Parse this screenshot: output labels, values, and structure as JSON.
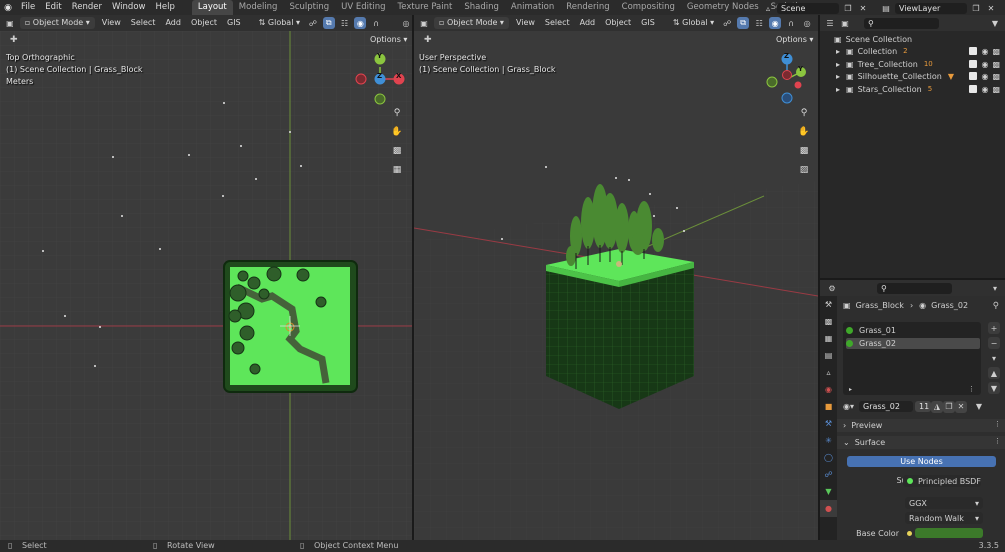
{
  "topbar": {
    "menus": [
      "File",
      "Edit",
      "Render",
      "Window",
      "Help"
    ],
    "workspaces": [
      "Layout",
      "Modeling",
      "Sculpting",
      "UV Editing",
      "Texture Paint",
      "Shading",
      "Animation",
      "Rendering",
      "Compositing",
      "Geometry Nodes",
      "Scripting"
    ],
    "active_workspace": "Layout",
    "add_tab": "+",
    "scene_name": "Scene",
    "view_layer": "ViewLayer"
  },
  "viewport_left": {
    "mode": "Object Mode",
    "menus": [
      "View",
      "Select",
      "Add",
      "Object",
      "GIS"
    ],
    "transform": "Global",
    "options": "Options",
    "info_line1": "Top Orthographic",
    "info_line2": "(1) Scene Collection | Grass_Block",
    "info_line3": "Meters",
    "axis_y": "Y",
    "axis_x": "X",
    "axis_z": "Z"
  },
  "viewport_right": {
    "mode": "Object Mode",
    "menus": [
      "View",
      "Select",
      "Add",
      "Object",
      "GIS"
    ],
    "transform": "Global",
    "options": "Options",
    "info_line1": "User Perspective",
    "info_line2": "(1) Scene Collection | Grass_Block",
    "axis_z": "Z",
    "axis_y": "Y"
  },
  "outliner": {
    "root": "Scene Collection",
    "items": [
      {
        "label": "Collection",
        "badge": "2"
      },
      {
        "label": "Tree_Collection",
        "badge": "10"
      },
      {
        "label": "Silhouette_Collection",
        "badge": ""
      },
      {
        "label": "Stars_Collection",
        "badge": "5"
      }
    ]
  },
  "properties": {
    "object_name": "Grass_Block",
    "material_breadcrumb": "Grass_02",
    "slots": [
      {
        "label": "Grass_01",
        "color": "#3fa82a"
      },
      {
        "label": "Grass_02",
        "color": "#3fa82a"
      }
    ],
    "material_name": "Grass_02",
    "user_count": "11",
    "preview_label": "Preview",
    "surface_panel": "Surface",
    "use_nodes": "Use Nodes",
    "surface_label": "Surface",
    "surface_value": "Principled BSDF",
    "distribution": "GGX",
    "subsurface": "Random Walk",
    "base_color_label": "Base Color",
    "base_color": "#3c7a2a"
  },
  "status": {
    "select": "Select",
    "rotate": "Rotate View",
    "context": "Object Context Menu",
    "version": "3.3.5"
  },
  "colors": {
    "accent": "#557aae",
    "grass": "#5ee65a",
    "axis_x": "#e0434f",
    "axis_y": "#8bc53f",
    "axis_z": "#3f8fd6"
  }
}
